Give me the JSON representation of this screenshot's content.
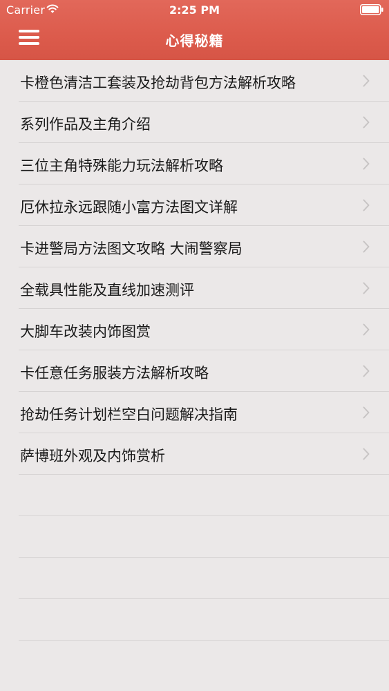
{
  "status_bar": {
    "carrier": "Carrier",
    "time": "2:25 PM",
    "wifi_icon": "wifi-icon",
    "battery_icon": "battery-icon"
  },
  "nav": {
    "title": "心得秘籍",
    "menu_icon": "hamburger-menu-icon"
  },
  "list": {
    "items": [
      {
        "label": "卡橙色清洁工套装及抢劫背包方法解析攻略"
      },
      {
        "label": "系列作品及主角介绍"
      },
      {
        "label": "三位主角特殊能力玩法解析攻略"
      },
      {
        "label": "厄休拉永远跟随小富方法图文详解"
      },
      {
        "label": "卡进警局方法图文攻略 大闹警察局"
      },
      {
        "label": "全载具性能及直线加速测评"
      },
      {
        "label": "大脚车改装内饰图赏"
      },
      {
        "label": "卡任意任务服装方法解析攻略"
      },
      {
        "label": "抢劫任务计划栏空白问题解决指南"
      },
      {
        "label": "萨博班外观及内饰赏析"
      }
    ],
    "chevron_icon": "chevron-right-icon"
  },
  "colors": {
    "header": "#dc5b4c",
    "background": "#ebe8e8",
    "separator": "#d6d3d3",
    "chevron": "#c7c4c4"
  }
}
